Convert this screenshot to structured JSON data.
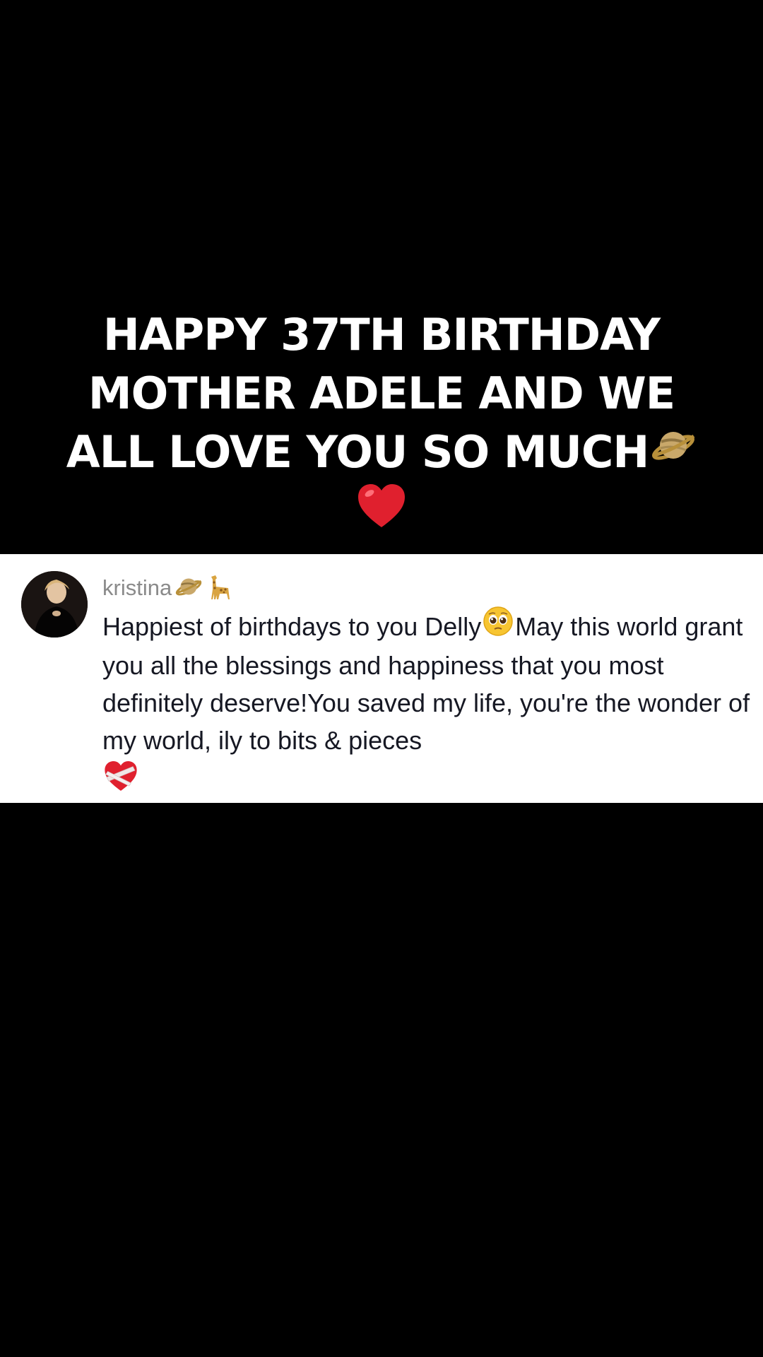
{
  "caption": {
    "line1": "HAPPY 37TH BIRTHDAY",
    "line2": "MOTHER ADELE AND WE",
    "line3": "ALL LOVE YOU SO MUCH",
    "icons": [
      "ringed-planet-icon",
      "red-heart-icon"
    ]
  },
  "comment": {
    "username": "kristina",
    "username_icons": [
      "ringed-planet-icon",
      "giraffe-icon"
    ],
    "text_part1": "Happiest of birthdays to you Delly",
    "text_part2": "May this world grant you all the blessings and happiness that you most definitely deserve!You saved my life, you're the wonder of my world, ily to bits & pieces",
    "text_icons": [
      "pleading-face-icon",
      "mending-heart-icon"
    ]
  },
  "colors": {
    "background": "#000000",
    "caption_text": "#ffffff",
    "card_background": "#ffffff",
    "username": "#8a8a8a",
    "comment_text": "#161823",
    "heart": "#e0202e"
  }
}
